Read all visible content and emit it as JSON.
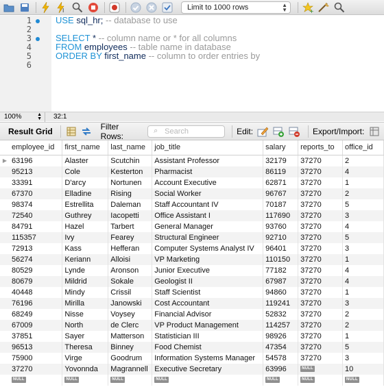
{
  "toolbar": {
    "limit_label": "Limit to 1000 rows",
    "icons": [
      "open-folder-icon",
      "save-icon",
      "execute-icon",
      "execute-current-icon",
      "explain-icon",
      "stop-icon",
      "toggle-continue-icon",
      "commit-icon",
      "rollback-icon",
      "autocommit-icon",
      "beautify-icon",
      "find-icon"
    ]
  },
  "editor": {
    "line_numbers": [
      "1",
      "2",
      "3",
      "4",
      "5",
      "6"
    ],
    "lines": [
      {
        "kw": "USE",
        "id": " sql_hr;",
        "cm": " -- database to use"
      },
      {
        "kw": "",
        "id": "",
        "cm": ""
      },
      {
        "kw": "SELECT",
        "id": " *",
        "cm": " -- column name or * for all columns"
      },
      {
        "kw": "FROM",
        "id": " employees",
        "cm": " -- table name in database"
      },
      {
        "kw": "ORDER BY",
        "id": " first_name",
        "cm": " -- column to order entries by"
      },
      {
        "kw": "",
        "id": "",
        "cm": ""
      }
    ],
    "zoom": "100%",
    "cursor_pos": "32:1"
  },
  "resultbar": {
    "tab_label": "Result Grid",
    "filter_label": "Filter Rows:",
    "search_placeholder": "Search",
    "edit_label": "Edit:",
    "export_label": "Export/Import:"
  },
  "grid": {
    "columns": [
      "employee_id",
      "first_name",
      "last_name",
      "job_title",
      "salary",
      "reports_to",
      "office_id"
    ],
    "null_label": "NULL",
    "rows": [
      [
        "63196",
        "Alaster",
        "Scutchin",
        "Assistant Professor",
        "32179",
        "37270",
        "2"
      ],
      [
        "95213",
        "Cole",
        "Kesterton",
        "Pharmacist",
        "86119",
        "37270",
        "4"
      ],
      [
        "33391",
        "D'arcy",
        "Nortunen",
        "Account Executive",
        "62871",
        "37270",
        "1"
      ],
      [
        "67370",
        "Elladine",
        "Rising",
        "Social Worker",
        "96767",
        "37270",
        "2"
      ],
      [
        "98374",
        "Estrellita",
        "Daleman",
        "Staff Accountant IV",
        "70187",
        "37270",
        "5"
      ],
      [
        "72540",
        "Guthrey",
        "Iacopetti",
        "Office Assistant I",
        "117690",
        "37270",
        "3"
      ],
      [
        "84791",
        "Hazel",
        "Tarbert",
        "General Manager",
        "93760",
        "37270",
        "4"
      ],
      [
        "115357",
        "Ivy",
        "Fearey",
        "Structural Engineer",
        "92710",
        "37270",
        "5"
      ],
      [
        "72913",
        "Kass",
        "Hefferan",
        "Computer Systems Analyst IV",
        "96401",
        "37270",
        "3"
      ],
      [
        "56274",
        "Keriann",
        "Alloisi",
        "VP Marketing",
        "110150",
        "37270",
        "1"
      ],
      [
        "80529",
        "Lynde",
        "Aronson",
        "Junior Executive",
        "77182",
        "37270",
        "4"
      ],
      [
        "80679",
        "Mildrid",
        "Sokale",
        "Geologist II",
        "67987",
        "37270",
        "4"
      ],
      [
        "40448",
        "Mindy",
        "Crissil",
        "Staff Scientist",
        "94860",
        "37270",
        "1"
      ],
      [
        "76196",
        "Mirilla",
        "Janowski",
        "Cost Accountant",
        "119241",
        "37270",
        "3"
      ],
      [
        "68249",
        "Nisse",
        "Voysey",
        "Financial Advisor",
        "52832",
        "37270",
        "2"
      ],
      [
        "67009",
        "North",
        "de Clerc",
        "VP Product Management",
        "114257",
        "37270",
        "2"
      ],
      [
        "37851",
        "Sayer",
        "Matterson",
        "Statistician III",
        "98926",
        "37270",
        "1"
      ],
      [
        "96513",
        "Theresa",
        "Binney",
        "Food Chemist",
        "47354",
        "37270",
        "5"
      ],
      [
        "75900",
        "Virge",
        "Goodrum",
        "Information Systems Manager",
        "54578",
        "37270",
        "3"
      ],
      [
        "37270",
        "Yovonnda",
        "Magrannell",
        "Executive Secretary",
        "63996",
        "NULL",
        "10"
      ],
      [
        "NULL",
        "NULL",
        "NULL",
        "NULL",
        "NULL",
        "NULL",
        "NULL"
      ]
    ]
  }
}
